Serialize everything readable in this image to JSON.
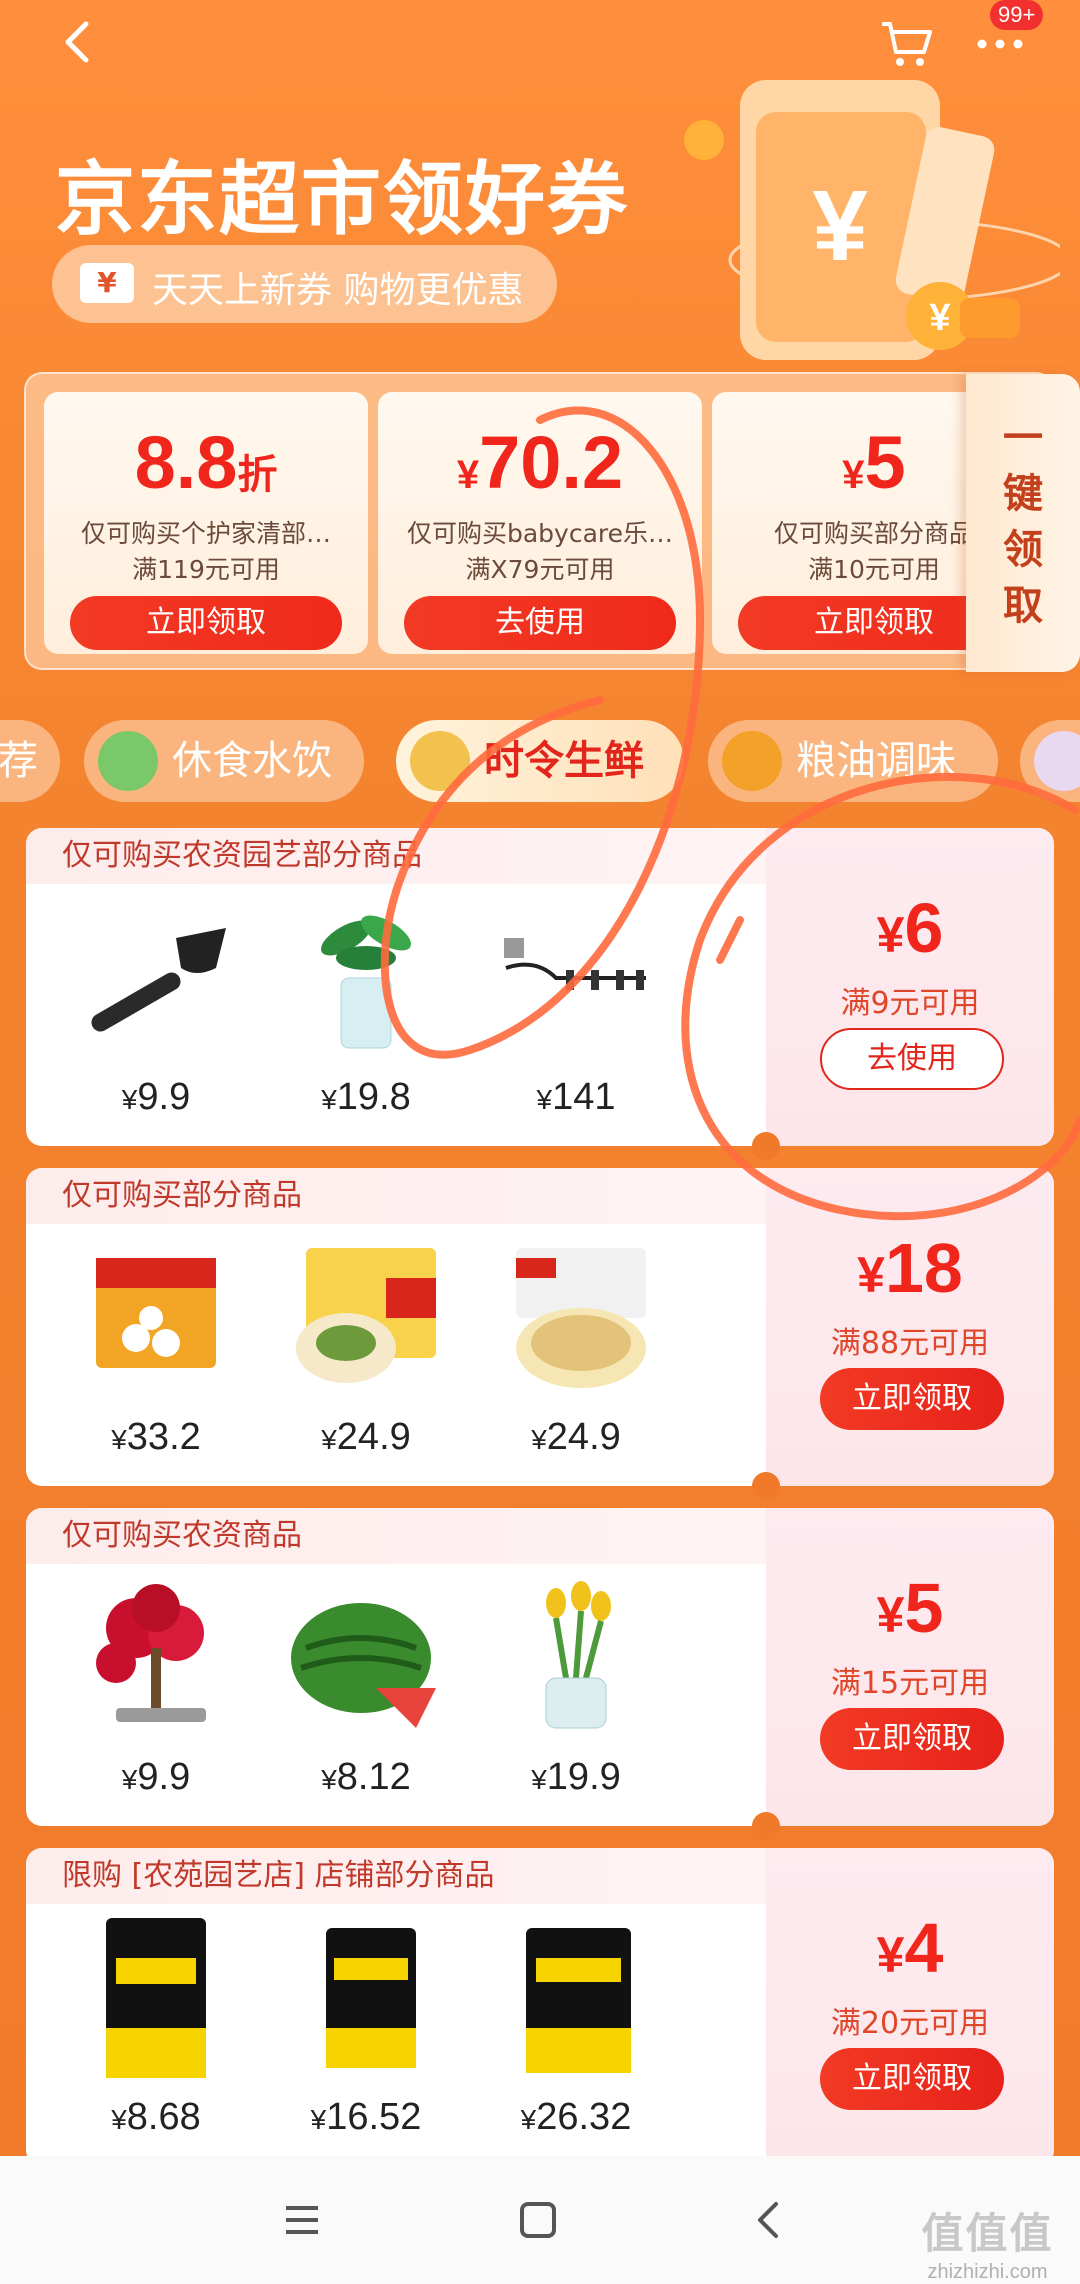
{
  "topbar": {
    "badge": "99+"
  },
  "hero": {
    "title": "京东超市领好券",
    "ticket_glyph": "¥",
    "subtitle": "天天上新券 购物更优惠"
  },
  "top_coupons": [
    {
      "amount": "8.8",
      "unit": "折",
      "prefix": "",
      "desc": "仅可购买个护家清部…",
      "cond": "满119元可用",
      "button": "立即领取"
    },
    {
      "amount": "70.2",
      "unit": "",
      "prefix": "¥",
      "desc": "仅可购买babycare乐…",
      "cond": "满X79元可用",
      "button": "去使用"
    },
    {
      "amount": "5",
      "unit": "",
      "prefix": "¥",
      "desc": "仅可购买部分商品",
      "cond": "满10元可用",
      "button": "立即领取"
    }
  ],
  "onekey": {
    "label": "一\n键\n领\n取"
  },
  "categories": [
    {
      "label": "荐"
    },
    {
      "label": "休食水饮"
    },
    {
      "label": "时令生鲜",
      "active": true
    },
    {
      "label": "粮油调味"
    }
  ],
  "cards": [
    {
      "head": "仅可购买农资园艺部分商品",
      "amount": "6",
      "cond": "满9元可用",
      "button": "去使用",
      "button_type": "use",
      "products": [
        {
          "price": "9.9",
          "icon": "shovel"
        },
        {
          "price": "19.8",
          "icon": "plant"
        },
        {
          "price": "141",
          "icon": "drip-irrigation"
        }
      ]
    },
    {
      "head": "仅可购买部分商品",
      "amount": "18",
      "cond": "满88元可用",
      "button": "立即领取",
      "button_type": "get",
      "products": [
        {
          "price": "33.2",
          "icon": "tangyuan"
        },
        {
          "price": "24.9",
          "icon": "dumplings"
        },
        {
          "price": "24.9",
          "icon": "wonton"
        }
      ]
    },
    {
      "head": "仅可购买农资商品",
      "amount": "5",
      "cond": "满15元可用",
      "button": "立即领取",
      "button_type": "get",
      "products": [
        {
          "price": "9.9",
          "icon": "bonsai"
        },
        {
          "price": "8.12",
          "icon": "watermelon"
        },
        {
          "price": "19.9",
          "icon": "tulips"
        }
      ]
    },
    {
      "head": "限购 [农苑园艺店] 店铺部分商品",
      "amount": "4",
      "cond": "满20元可用",
      "button": "立即领取",
      "button_type": "get",
      "products": [
        {
          "price": "8.68",
          "icon": "fertilizer-bag"
        },
        {
          "price": "16.52",
          "icon": "fertilizer-bag"
        },
        {
          "price": "26.32",
          "icon": "fertilizer-bag"
        }
      ]
    }
  ],
  "currency_symbol": "¥",
  "watermark": {
    "line1": "值值值",
    "line2": "zhizhizhi.com"
  },
  "colors": {
    "accent": "#f0261d",
    "background": "#f4832f",
    "annotation": "#ff6a3d"
  }
}
